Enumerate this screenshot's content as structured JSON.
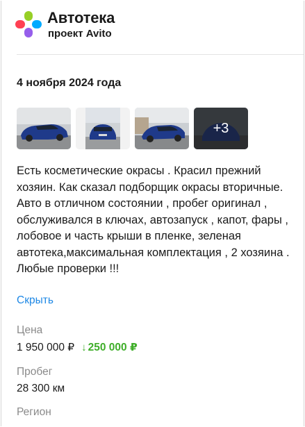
{
  "header": {
    "title": "Автотека",
    "subtitle": "проект Avito"
  },
  "report": {
    "date": "4 ноября 2024 года",
    "photos_more": "+3",
    "description": "Есть косметические окрасы . Красил прежний хозяин. Как сказал подборщик окрасы вторичные. Авто в отличном состоянии , пробег оригинал , обслуживался в ключах, автозапуск , капот, фары , лобовое и часть крыши в пленке, зеленая автотека,максимальная комплектация , 2 хозяина . Любые проверки !!!",
    "hide_label": "Скрыть"
  },
  "details": {
    "price_label": "Цена",
    "price_value": "1 950 000 ₽",
    "price_drop": "250 000 ₽",
    "mileage_label": "Пробег",
    "mileage_value": "28 300 км",
    "region_label": "Регион"
  },
  "colors": {
    "link": "#1e88e5",
    "price_drop": "#3fae2a",
    "car_body": "#1f3a8a"
  },
  "icons": {
    "logo": "avtoteka-logo-icon",
    "drop_arrow": "arrow-down-icon"
  }
}
